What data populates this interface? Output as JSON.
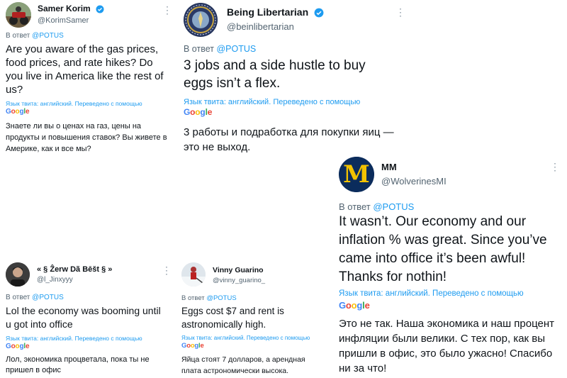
{
  "common": {
    "reply_prefix": "В ответ",
    "mention": "@POTUS",
    "translation_note": "Язык твита: английский. Переведено с помощью",
    "google_letters": [
      "G",
      "o",
      "o",
      "g",
      "l",
      "e"
    ],
    "google_colors": [
      "#4285F4",
      "#EA4335",
      "#FBBC05",
      "#4285F4",
      "#34A853",
      "#EA4335"
    ],
    "more_icon": "⋮"
  },
  "tweets": [
    {
      "name": "Samer Korim",
      "handle": "@KorimSamer",
      "verified": true,
      "avatar": "atv-photo",
      "text": "Are you aware of the gas prices, food prices, and rate hikes? Do you live in America like the rest of us?",
      "translation": "Знаете ли вы о ценах на газ, цены на продукты и повышения ставок? Вы живете в Америке, как и все мы?"
    },
    {
      "name": "Being Libertarian",
      "handle": "@beinlibertarian",
      "verified": true,
      "avatar": "libertarian-seal",
      "text": "3 jobs and a side hustle to buy eggs isn’t a flex.",
      "translation": "3 работы и подработка для покупки яиц — это не выход."
    },
    {
      "name": "MM",
      "handle": "@WolverinesMI",
      "verified": false,
      "avatar": "michigan-m-logo",
      "avatar_letter": "M",
      "text": "It wasn’t. Our economy and our inflation % was great. Since you’ve came into office it’s been awful! Thanks for nothin!",
      "translation": "Это не так. Наша экономика и наш процент инфляции были велики. С тех пор, как вы пришли в офис, это было ужасно! Спасибо ни за что!"
    },
    {
      "name": "« § Ẑerw Dã Bēšt § »",
      "handle": "@l_Jinxyyy",
      "verified": false,
      "avatar": "person-photo",
      "text": "Lol the economy was booming until u got into office",
      "translation": "Лол, экономика процветала, пока ты не пришел в офис"
    },
    {
      "name": "Vinny Guarino",
      "handle": "@vinny_guarino_",
      "verified": false,
      "avatar": "hockey-photo",
      "text": "Eggs cost $7 and rent is astronomically high.",
      "translation": "Яйца стоят 7 долларов, а арендная плата астрономически высока."
    }
  ]
}
